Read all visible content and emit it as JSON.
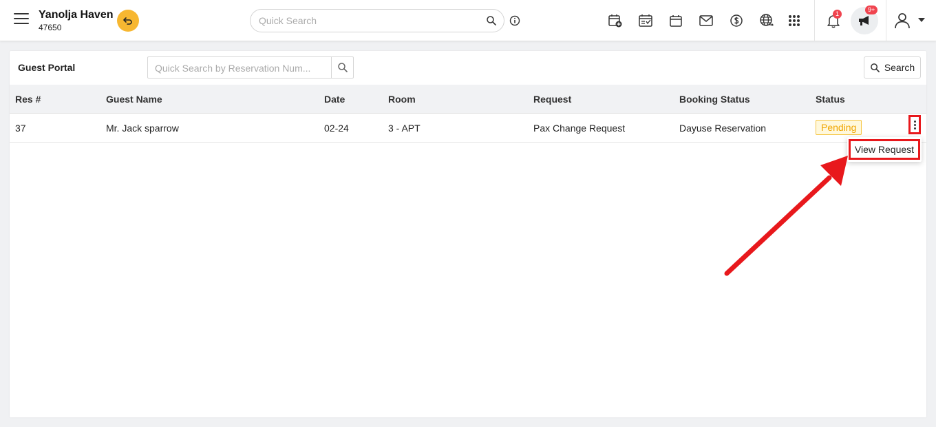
{
  "header": {
    "property_name": "Yanolja Haven",
    "property_id": "47650",
    "search_placeholder": "Quick Search",
    "notification_count": "1",
    "announcement_count": "9+"
  },
  "icons": {
    "menu": "hamburger-icon",
    "back": "undo-icon",
    "search": "search-icon",
    "info": "info-icon",
    "toolbar": [
      "calendar-add-icon",
      "calendar-check-icon",
      "calendar-icon",
      "mail-icon",
      "dollar-icon",
      "globe-icon",
      "apps-grid-icon"
    ],
    "bell": "bell-icon",
    "announce": "megaphone-icon",
    "user": "user-icon"
  },
  "panel": {
    "title": "Guest Portal",
    "search_placeholder": "Quick Search by Reservation Num...",
    "search_button": "Search"
  },
  "table": {
    "columns": [
      "Res #",
      "Guest Name",
      "Date",
      "Room",
      "Request",
      "Booking Status",
      "Status"
    ],
    "rows": [
      {
        "res": "37",
        "guest": "Mr. Jack sparrow",
        "date": "02-24",
        "room": "3 - APT",
        "request": "Pax Change Request",
        "booking_status": "Dayuse Reservation",
        "status": "Pending"
      }
    ]
  },
  "row_menu": {
    "view_request": "View Request"
  },
  "colors": {
    "accent": "#f7b731",
    "highlight": "#e8181c",
    "pending_text": "#f0a500",
    "badge": "#f0444f"
  }
}
